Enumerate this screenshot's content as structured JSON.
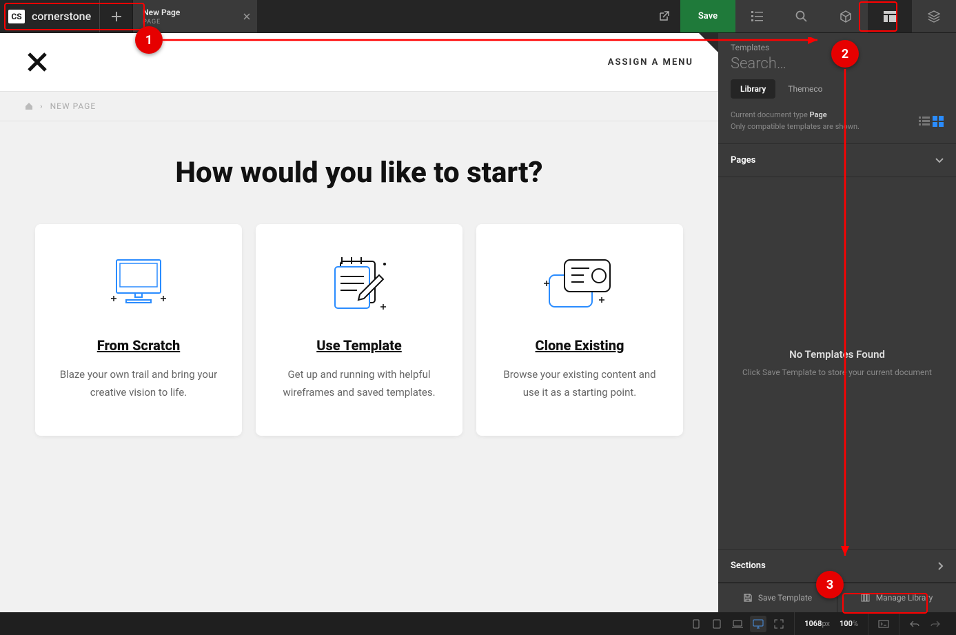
{
  "app": {
    "brand": "cornerstone",
    "brand_badge": "CS"
  },
  "tab": {
    "title": "New Page",
    "subtitle": "PAGE"
  },
  "topbar": {
    "save": "Save"
  },
  "header": {
    "menu": "ASSIGN A MENU"
  },
  "breadcrumbs": {
    "current": "NEW PAGE"
  },
  "hero": {
    "title": "How would you like to start?",
    "cards": [
      {
        "title": "From Scratch",
        "desc": "Blaze your own trail and bring your creative vision to life."
      },
      {
        "title": "Use Template",
        "desc": "Get up and running with helpful wireframes and saved templates."
      },
      {
        "title": "Clone Existing",
        "desc": "Browse your existing content and use it as a starting point."
      }
    ]
  },
  "sidebar": {
    "heading": "Templates",
    "search_placeholder": "Search…",
    "tabs": {
      "library": "Library",
      "themeco": "Themeco"
    },
    "info_line1a": "Current document type ",
    "info_line1b": "Page",
    "info_line2": "Only compatible templates are shown.",
    "sections": {
      "pages": "Pages",
      "sections": "Sections"
    },
    "empty": {
      "title": "No Templates Found",
      "desc": "Click Save Template to store your current document"
    },
    "footer": {
      "save": "Save Template",
      "manage": "Manage Library"
    }
  },
  "bottombar": {
    "width": "1068",
    "px": "px",
    "zoom": "100",
    "pct": "%"
  },
  "annotations": {
    "n1": "1",
    "n2": "2",
    "n3": "3"
  }
}
